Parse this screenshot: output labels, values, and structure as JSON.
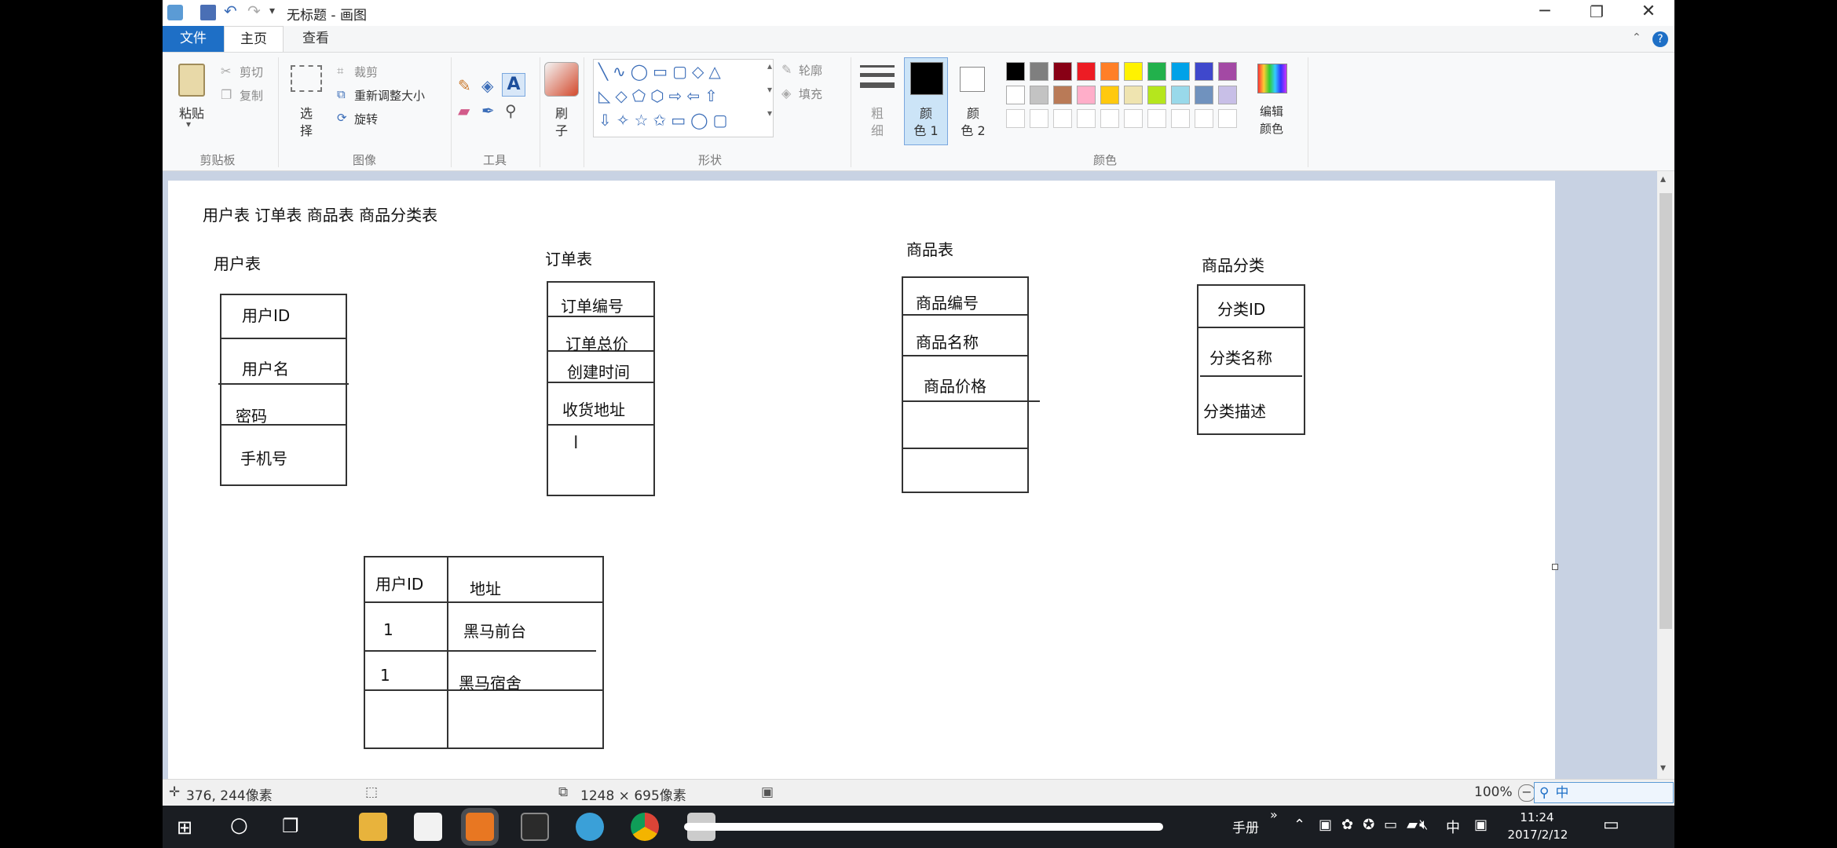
{
  "window": {
    "title": "无标题 - 画图",
    "controls": {
      "minimize": "─",
      "maximize": "❐",
      "close": "✕"
    },
    "help": "?"
  },
  "tabs": {
    "file": "文件",
    "home": "主页",
    "view": "查看"
  },
  "ribbon": {
    "clipboard": {
      "paste": "粘贴",
      "cut": "剪切",
      "copy": "复制",
      "label": "剪贴板"
    },
    "image": {
      "select_line1": "选",
      "select_line2": "择",
      "crop": "裁剪",
      "resize": "重新调整大小",
      "rotate": "旋转",
      "label": "图像"
    },
    "tools": {
      "label": "工具",
      "text_icon": "A"
    },
    "brush": {
      "line1": "刷",
      "line2": "子"
    },
    "shapes": {
      "label": "形状",
      "outline": "轮廓",
      "fill": "填充"
    },
    "size": {
      "line1": "粗",
      "line2": "细"
    },
    "colors": {
      "color1_line1": "颜",
      "color1_line2": "色 1",
      "color2_line1": "颜",
      "color2_line2": "色 2",
      "edit_line1": "编辑",
      "edit_line2": "颜色",
      "label": "颜色",
      "row1": [
        "#000000",
        "#7f7f7f",
        "#880015",
        "#ed1c24",
        "#ff7f27",
        "#fff200",
        "#22b14c",
        "#00a2e8",
        "#3f48cc",
        "#a349a4"
      ],
      "row2": [
        "#ffffff",
        "#c3c3c3",
        "#b97a57",
        "#ffaec9",
        "#ffc90e",
        "#efe4b0",
        "#b5e61d",
        "#99d9ea",
        "#7092be",
        "#c8bfe7"
      ]
    }
  },
  "canvas": {
    "heading": "用户表 订单表 商品表 商品分类表",
    "user_table": {
      "title": "用户表",
      "fields": [
        "用户ID",
        "用户名",
        "密码",
        "手机号"
      ]
    },
    "order_table": {
      "title": "订单表",
      "fields": [
        "订单编号",
        "订单总价",
        "创建时间",
        "收货地址"
      ]
    },
    "product_table": {
      "title": "商品表",
      "fields": [
        "商品编号",
        "商品名称",
        "商品价格"
      ]
    },
    "category_table": {
      "title": "商品分类",
      "fields": [
        "分类ID",
        "分类名称",
        "分类描述"
      ]
    },
    "address_table": {
      "headers": [
        "用户ID",
        "地址"
      ],
      "rows": [
        [
          "1",
          "黑马前台"
        ],
        [
          "1",
          "黑马宿舍"
        ]
      ]
    },
    "cursor": "I"
  },
  "status": {
    "cursor_pos": "376, 244像素",
    "canvas_size": "1248 × 695像素",
    "zoom": "100%"
  },
  "taskbar": {
    "ime_label": "手册",
    "lang": "中",
    "time": "11:24",
    "date": "2017/2/12"
  }
}
